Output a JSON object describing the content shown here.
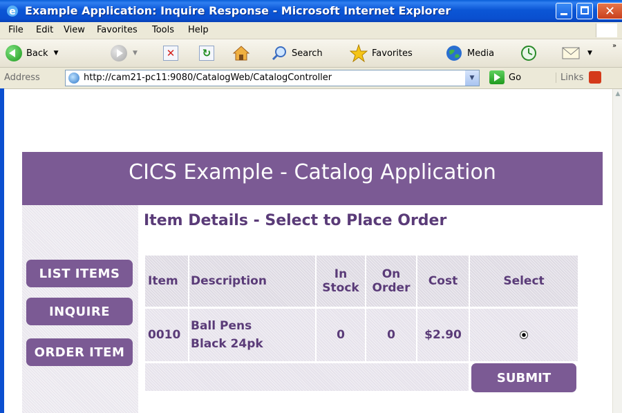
{
  "window": {
    "title": "Example Application: Inquire Response - Microsoft Internet Explorer"
  },
  "menu": {
    "items": [
      "File",
      "Edit",
      "View",
      "Favorites",
      "Tools",
      "Help"
    ]
  },
  "toolbar": {
    "back_label": "Back",
    "search_label": "Search",
    "favorites_label": "Favorites",
    "media_label": "Media"
  },
  "address": {
    "label": "Address",
    "url": "http://cam21-pc11:9080/CatalogWeb/CatalogController",
    "go_label": "Go",
    "links_label": "Links"
  },
  "page": {
    "banner_title": "CICS Example - Catalog Application",
    "subheading": "Item Details - Select to Place Order",
    "nav": [
      "LIST ITEMS",
      "INQUIRE",
      "ORDER ITEM"
    ],
    "table": {
      "headers": {
        "item": "Item",
        "description": "Description",
        "in_stock_1": "In",
        "in_stock_2": "Stock",
        "on_order_1": "On",
        "on_order_2": "Order",
        "cost": "Cost",
        "select": "Select"
      },
      "row": {
        "item": "0010",
        "description_1": "Ball Pens",
        "description_2": "Black 24pk",
        "in_stock": "0",
        "on_order": "0",
        "cost": "$2.90",
        "selected": true
      },
      "submit_label": "SUBMIT"
    }
  },
  "colors": {
    "accent": "#7b5a94",
    "text_accent": "#5a3b78",
    "titlebar": "#0a4fcf"
  }
}
